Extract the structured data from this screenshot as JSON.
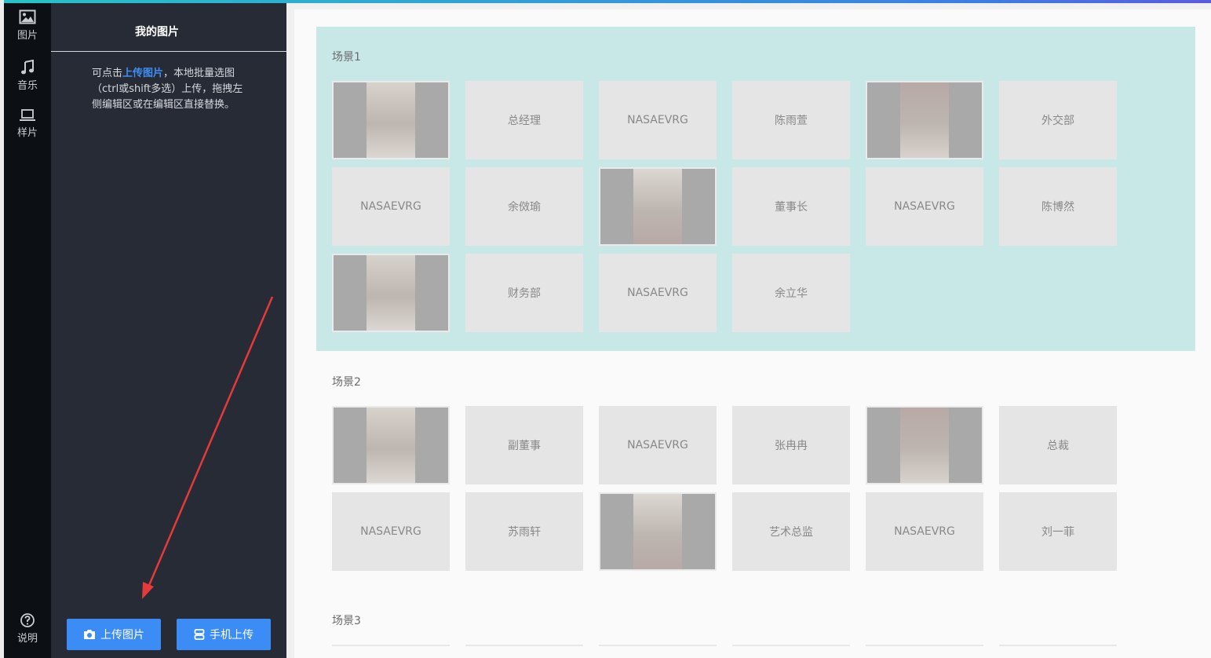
{
  "rail": {
    "items": [
      {
        "label": "图片",
        "icon": "image-icon"
      },
      {
        "label": "音乐",
        "icon": "music-icon"
      },
      {
        "label": "样片",
        "icon": "laptop-icon"
      }
    ],
    "help": {
      "label": "说明",
      "icon": "help-icon"
    }
  },
  "panel": {
    "title": "我的图片",
    "hint_prefix": "可点击",
    "hint_link": "上传图片",
    "hint_suffix": "，本地批量选图（ctrl或shift多选）上传，拖拽左侧编辑区或在编辑区直接替换。",
    "upload_button": "上传图片",
    "mobile_upload_button": "手机上传"
  },
  "colors": {
    "accent": "#3b8cf4",
    "rail_bg": "#0c1015",
    "panel_bg": "#262b35",
    "scene_highlight": "#c8e8e8",
    "arrow": "#e63a3a"
  },
  "scenes": [
    {
      "title": "场景1",
      "tiles": [
        {
          "type": "photo",
          "label": ""
        },
        {
          "type": "text",
          "label": "总经理"
        },
        {
          "type": "text",
          "label": "NASAEVRG"
        },
        {
          "type": "text",
          "label": "陈雨萱"
        },
        {
          "type": "photo",
          "label": ""
        },
        {
          "type": "text",
          "label": "外交部"
        },
        {
          "type": "text",
          "label": "NASAEVRG"
        },
        {
          "type": "text",
          "label": "余傚瑜"
        },
        {
          "type": "photo",
          "label": ""
        },
        {
          "type": "text",
          "label": "董事长"
        },
        {
          "type": "text",
          "label": "NASAEVRG"
        },
        {
          "type": "text",
          "label": "陈博然"
        },
        {
          "type": "photo",
          "label": ""
        },
        {
          "type": "text",
          "label": "财务部"
        },
        {
          "type": "text",
          "label": "NASAEVRG"
        },
        {
          "type": "text",
          "label": "余立华"
        }
      ]
    },
    {
      "title": "场景2",
      "tiles": [
        {
          "type": "photo",
          "label": ""
        },
        {
          "type": "text",
          "label": "副董事"
        },
        {
          "type": "text",
          "label": "NASAEVRG"
        },
        {
          "type": "text",
          "label": "张冉冉"
        },
        {
          "type": "photo",
          "label": ""
        },
        {
          "type": "text",
          "label": "总裁"
        },
        {
          "type": "text",
          "label": "NASAEVRG"
        },
        {
          "type": "text",
          "label": "苏雨轩"
        },
        {
          "type": "photo",
          "label": ""
        },
        {
          "type": "text",
          "label": "艺术总监"
        },
        {
          "type": "text",
          "label": "NASAEVRG"
        },
        {
          "type": "text",
          "label": "刘一菲"
        }
      ]
    },
    {
      "title": "场景3",
      "tiles": []
    }
  ]
}
